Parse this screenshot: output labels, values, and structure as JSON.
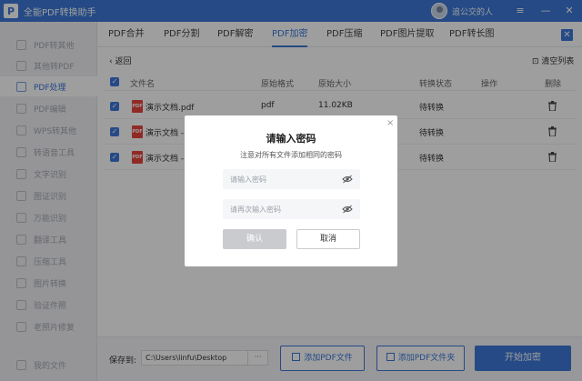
{
  "titlebar": {
    "logo_letter": "P",
    "title": "全能PDF转换助手",
    "user_name": "追公交的人",
    "controls": [
      "≡",
      "—",
      "✕"
    ]
  },
  "sidebar": {
    "items": [
      {
        "label": "PDF转其他"
      },
      {
        "label": "其他转PDF"
      },
      {
        "label": "PDF处理"
      },
      {
        "label": "PDF编辑"
      },
      {
        "label": "WPS转其他"
      },
      {
        "label": "转语音工具"
      },
      {
        "label": "文字识别"
      },
      {
        "label": "图证识别"
      },
      {
        "label": "万能识别"
      },
      {
        "label": "翻译工具"
      },
      {
        "label": "压缩工具"
      },
      {
        "label": "图片转换"
      },
      {
        "label": "验证件照"
      },
      {
        "label": "老照片修复"
      },
      {
        "label": "我的文件"
      }
    ],
    "active_label": "PDF处理"
  },
  "tabs": [
    {
      "label": "PDF合并"
    },
    {
      "label": "PDF分割"
    },
    {
      "label": "PDF解密"
    },
    {
      "label": "PDF加密"
    },
    {
      "label": "PDF压缩"
    },
    {
      "label": "PDF图片提取"
    },
    {
      "label": "PDF转长图"
    }
  ],
  "active_tab": "PDF加密",
  "toolbar": {
    "back_label": "‹  返回",
    "clear_label": "清空列表"
  },
  "table": {
    "headers": [
      "文件名",
      "原始格式",
      "原始大小",
      "转换状态",
      "操作",
      "删除"
    ],
    "rows": [
      {
        "file_name": "演示文档.pdf",
        "format": "pdf",
        "size": "11.02KB",
        "status": "待转换"
      },
      {
        "file_name": "演示文档 - (",
        "format": "",
        "size": "",
        "status": "待转换"
      },
      {
        "file_name": "演示文档 - (",
        "format": "",
        "size": "",
        "status": "待转换"
      }
    ]
  },
  "bottom": {
    "save_label": "保存到:",
    "save_path": "C:\\Users\\linfu\\Desktop",
    "more_label": "···",
    "add_file_label": "添加PDF文件",
    "add_folder_label": "添加PDF文件夹",
    "start_label": "开始加密"
  },
  "dialog": {
    "close": "×",
    "title": "请输入密码",
    "subtitle": "注意对所有文件添加相同的密码",
    "password_placeholder": "请输入密码",
    "confirm_placeholder": "请再次输入密码",
    "confirm_label": "确认",
    "cancel_label": "取消"
  },
  "colors": {
    "accent": "#3c78d8",
    "pdf_red": "#e8453c",
    "sidebar_bg": "#f0f1f4",
    "disabled_button": "#c9cbcf"
  }
}
